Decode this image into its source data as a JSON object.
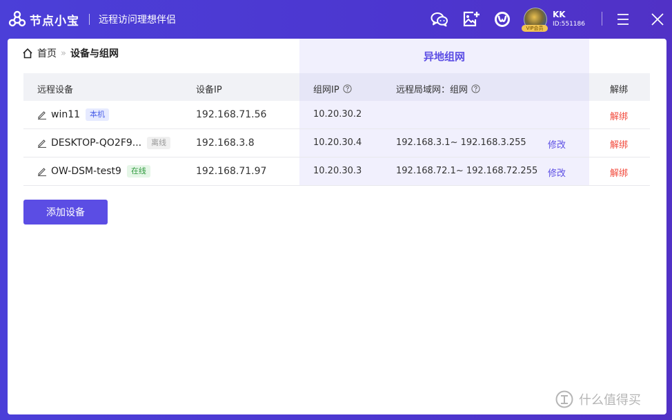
{
  "app": {
    "name": "节点小宝",
    "slogan": "远程访问理想伴侣",
    "colors": {
      "brand": "#4b3fd8",
      "accent": "#5b4de4",
      "danger": "#f24a3c"
    }
  },
  "titlebar": {
    "icons": [
      "wechat-icon",
      "image-add-icon",
      "support-icon",
      "menu-icon",
      "close-icon"
    ],
    "user": {
      "name": "KK",
      "id": "ID:551186",
      "vip_badge": "VIP会员"
    }
  },
  "breadcrumb": {
    "home": "首页",
    "separator": "»",
    "current": "设备与组网"
  },
  "remote_section_title": "异地组网",
  "table": {
    "headers": {
      "device": "远程设备",
      "device_ip": "设备IP",
      "network_ip": "组网IP",
      "lan": "远程局域网：组网",
      "unbind": "解绑"
    },
    "rows": [
      {
        "name": "win11",
        "tag": "本机",
        "tag_type": "local",
        "device_ip": "192.168.71.56",
        "network_ip": "10.20.30.2",
        "lan": "",
        "modify": "",
        "unbind": "解绑"
      },
      {
        "name": "DESKTOP-QO2F9...",
        "tag": "离线",
        "tag_type": "offline",
        "device_ip": "192.168.3.8",
        "network_ip": "10.20.30.4",
        "lan": "192.168.3.1~ 192.168.3.255",
        "modify": "修改",
        "unbind": "解绑"
      },
      {
        "name": "OW-DSM-test9",
        "tag": "在线",
        "tag_type": "online",
        "device_ip": "192.168.71.97",
        "network_ip": "10.20.30.3",
        "lan": "192.168.72.1~ 192.168.72.255",
        "modify": "修改",
        "unbind": "解绑"
      }
    ]
  },
  "add_device_label": "添加设备",
  "watermark": "什么值得买"
}
